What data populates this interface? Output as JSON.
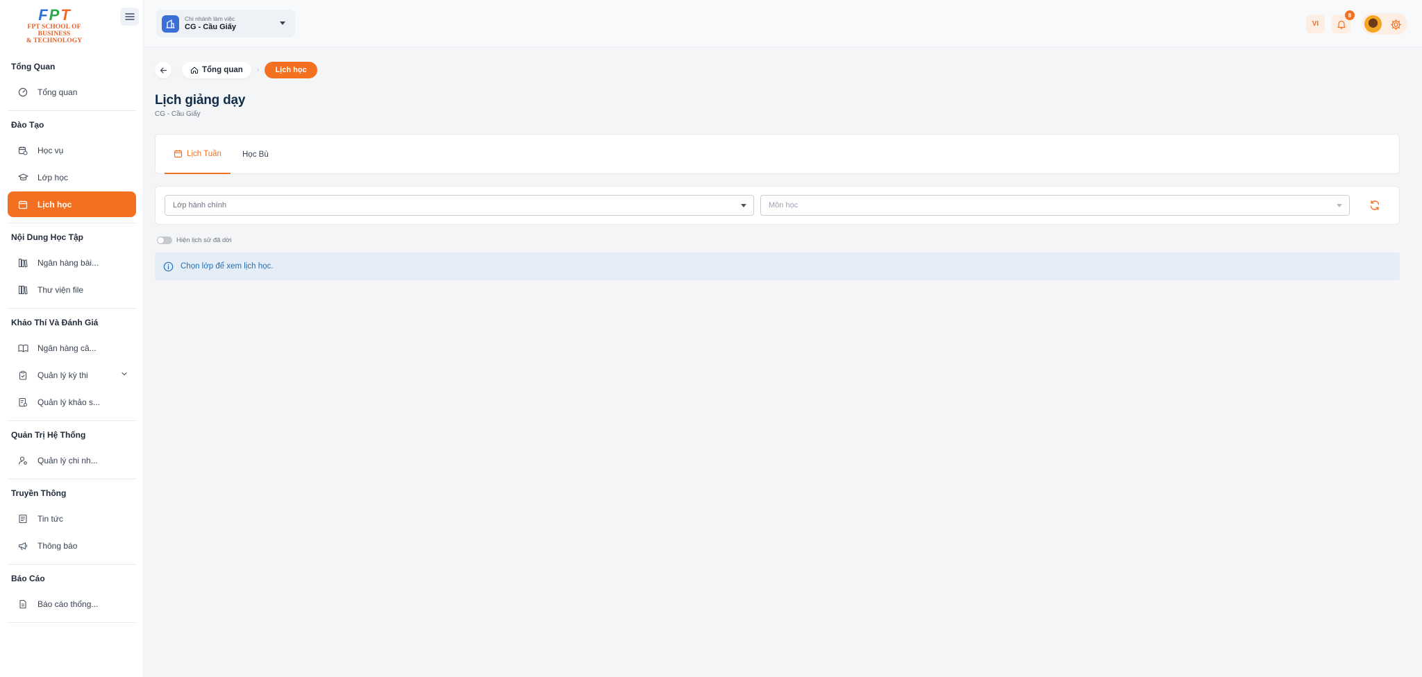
{
  "brand": {
    "logo_letters": [
      "F",
      "P",
      "T"
    ],
    "logo_line1": "FPT SCHOOL OF BUSINESS",
    "logo_line2": "& TECHNOLOGY",
    "colors": {
      "accent": "#f37021",
      "blue": "#2f6fd6",
      "green": "#2aa84a"
    }
  },
  "sidebar": {
    "sections": [
      {
        "title": "Tổng Quan",
        "items": [
          {
            "label": "Tổng quan",
            "icon": "dashboard-gauge-icon"
          }
        ]
      },
      {
        "title": "Đào Tạo",
        "items": [
          {
            "label": "Học vụ",
            "icon": "calendar-clock-icon"
          },
          {
            "label": "Lớp học",
            "icon": "graduation-cap-icon"
          },
          {
            "label": "Lịch học",
            "icon": "calendar-icon",
            "active": true
          }
        ]
      },
      {
        "title": "Nội Dung Học Tập",
        "items": [
          {
            "label": "Ngân hàng bài...",
            "icon": "library-icon"
          },
          {
            "label": "Thư viện file",
            "icon": "file-library-icon"
          }
        ]
      },
      {
        "title": "Khảo Thí Và Đánh Giá",
        "items": [
          {
            "label": "Ngân hàng câ...",
            "icon": "open-book-icon"
          },
          {
            "label": "Quản lý kỳ thi",
            "icon": "clipboard-check-icon",
            "expandable": true
          },
          {
            "label": "Quản lý khảo s...",
            "icon": "survey-icon"
          }
        ]
      },
      {
        "title": "Quản Trị Hệ Thống",
        "items": [
          {
            "label": "Quản lý chi nh...",
            "icon": "user-settings-icon"
          }
        ]
      },
      {
        "title": "Truyền Thông",
        "items": [
          {
            "label": "Tin tức",
            "icon": "newspaper-icon"
          },
          {
            "label": "Thông báo",
            "icon": "megaphone-icon"
          }
        ]
      },
      {
        "title": "Báo Cáo",
        "items": [
          {
            "label": "Báo cáo thống...",
            "icon": "report-file-icon"
          }
        ]
      }
    ]
  },
  "header": {
    "branch_label": "Chi nhánh làm việc",
    "branch_value": "CG - Cầu Giấy",
    "language": "VI",
    "notification_count": "8"
  },
  "breadcrumb": {
    "home": "Tổng quan",
    "current": "Lịch học"
  },
  "page": {
    "title": "Lịch giảng dạy",
    "subtitle": "CG - Cầu Giấy"
  },
  "tabs": [
    {
      "label": "Lịch Tuần",
      "active": true
    },
    {
      "label": "Học Bù",
      "active": false
    }
  ],
  "filters": {
    "class_placeholder": "Lớp hành chính",
    "subject_placeholder": "Môn học"
  },
  "toggle": {
    "label": "Hiện lịch sử đã dời",
    "on": false
  },
  "alert": {
    "text": "Chọn lớp để xem lịch học."
  }
}
